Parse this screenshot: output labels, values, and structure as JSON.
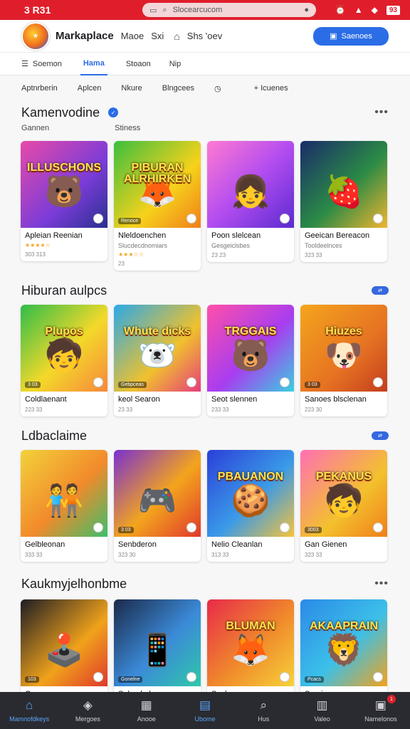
{
  "status": {
    "time": "3 R31",
    "url": "Slocearcucom",
    "battery": "93"
  },
  "appbar": {
    "brand": "Markaplace",
    "nav1": "Maoe",
    "nav2": "Sxi",
    "nav3": "Shs 'oev",
    "cta_label": "Saenoes"
  },
  "tabs": [
    {
      "label": "Soemon",
      "active": false
    },
    {
      "label": "Hama",
      "active": true
    },
    {
      "label": "Stoaon",
      "active": false
    },
    {
      "label": "Nip",
      "active": false
    }
  ],
  "filters": [
    "Aptnrberin",
    "Aplcen",
    "Nkure",
    "Blngcees",
    "+ Icuenes"
  ],
  "sections": [
    {
      "title": "Kamenvodine",
      "verified": true,
      "trailing": "dots",
      "sublabels": [
        "Gannen",
        "Stiness"
      ],
      "cards": [
        {
          "art_title": "ILLUSCHONS",
          "glyph": "🐻",
          "bg": "linear-gradient(135deg,#e84aa8,#7a3cd8 60%,#2b2f8f)",
          "name": "Apleian Reenian",
          "desc": "",
          "stars": "★★★★☆",
          "price": "303 313",
          "badge": ""
        },
        {
          "art_title": "PIBURAN ALRHIRKEN",
          "glyph": "🦊",
          "bg": "linear-gradient(135deg,#3bbf3f,#f6d21b 60%,#f07e1a)",
          "name": "Nleldoenchen",
          "desc": "Slucdecdnomiars",
          "stars": "★★★☆☆",
          "price": "23",
          "badge": "Renoce"
        },
        {
          "art_title": "",
          "glyph": "👧",
          "bg": "linear-gradient(135deg,#ff7ad1,#b34df0 50%,#5a2bd0)",
          "name": "Poon slelcean",
          "desc": "Gesgeiclsbes",
          "stars": "",
          "price": "23 23",
          "badge": ""
        },
        {
          "art_title": "",
          "glyph": "🍓",
          "bg": "linear-gradient(135deg,#1a2b6a,#2a8a46 55%,#f1b52e)",
          "name": "Geeican Bereacon",
          "desc": "Tooldeelnces",
          "stars": "",
          "price": "323 33",
          "badge": ""
        }
      ]
    },
    {
      "title": "Hiburan aulpcs",
      "verified": false,
      "trailing": "pill",
      "sublabels": [],
      "cards": [
        {
          "art_title": "Plupos",
          "glyph": "🧒",
          "bg": "linear-gradient(135deg,#2ebd4a,#f3d92a 55%,#f7873a)",
          "name": "Coldlaenant",
          "desc": "",
          "stars": "",
          "price": "223 33",
          "badge": "3 03"
        },
        {
          "art_title": "Whute dicks",
          "glyph": "🐻‍❄️",
          "bg": "linear-gradient(135deg,#2aa9e8,#f0c12d 60%,#e63d7d)",
          "name": "keol Searon",
          "desc": "",
          "stars": "",
          "price": "23 33",
          "badge": "Gebpceas"
        },
        {
          "art_title": "TRGGAIS",
          "glyph": "🐻",
          "bg": "linear-gradient(135deg,#ff4fa8,#a83df0 55%,#3ad0e0)",
          "name": "Seot slennen",
          "desc": "",
          "stars": "",
          "price": "233 33",
          "badge": ""
        },
        {
          "art_title": "Hiuzes",
          "glyph": "🐶",
          "bg": "linear-gradient(135deg,#f4a51d,#e67322 60%,#c43d1d)",
          "name": "Sanoes blsclenan",
          "desc": "",
          "stars": "",
          "price": "223 30",
          "badge": "3 03"
        }
      ]
    },
    {
      "title": "Ldbaclaime",
      "verified": false,
      "trailing": "pill",
      "sublabels": [],
      "cards": [
        {
          "art_title": "",
          "glyph": "🧑‍🤝‍🧑",
          "bg": "linear-gradient(135deg,#f2d23a,#f28a2b 55%,#3cbf6b)",
          "name": "Gelbleonan",
          "desc": "",
          "stars": "",
          "price": "333 33",
          "badge": ""
        },
        {
          "art_title": "",
          "glyph": "🎮",
          "bg": "linear-gradient(135deg,#7a2fd0,#f3a51d 55%,#e0382b)",
          "name": "Senbderon",
          "desc": "",
          "stars": "",
          "price": "323 30",
          "badge": "3 03"
        },
        {
          "art_title": "PBAUANON",
          "glyph": "🍪",
          "bg": "linear-gradient(135deg,#2b3fd8,#3a9ae8 55%,#f6c33a)",
          "name": "Nelio Cleanlan",
          "desc": "",
          "stars": "",
          "price": "313 33",
          "badge": ""
        },
        {
          "art_title": "PEKANUS",
          "glyph": "🧒",
          "bg": "linear-gradient(135deg,#ff6fb5,#f3c12d 60%,#f07e1a)",
          "name": "Gan Gienen",
          "desc": "",
          "stars": "",
          "price": "323 33",
          "badge": "3003"
        }
      ]
    },
    {
      "title": "Kaukmyjelhonbme",
      "verified": false,
      "trailing": "dots",
      "sublabels": [],
      "cards": [
        {
          "art_title": "",
          "glyph": "🕹️",
          "bg": "linear-gradient(135deg,#1d1d25,#f0a21b 60%,#e0382b)",
          "name": "Gas",
          "desc": "",
          "stars": "",
          "price": "",
          "badge": "103"
        },
        {
          "art_title": "",
          "glyph": "📱",
          "bg": "linear-gradient(135deg,#1b2a4a,#3b8ad8 55%,#2fc8a8)",
          "name": "Salue bol",
          "desc": "",
          "stars": "",
          "price": "",
          "badge": "Gonelne"
        },
        {
          "art_title": "BLUMAN",
          "glyph": "🦊",
          "bg": "linear-gradient(135deg,#e82a4a,#f08a2b 55%,#f6d23a)",
          "name": "Seclon",
          "desc": "",
          "stars": "",
          "price": "",
          "badge": ""
        },
        {
          "art_title": "AKAAPRAIN",
          "glyph": "🦁",
          "bg": "linear-gradient(135deg,#2b8ae8,#3cc0e8 55%,#f3a21b)",
          "name": "Sereion",
          "desc": "",
          "stars": "",
          "price": "",
          "badge": "Pcacs"
        }
      ]
    }
  ],
  "bottomnav": [
    {
      "label": "Mamnofdkeys",
      "icon": "home-icon",
      "glyph": "⌂",
      "active": true
    },
    {
      "label": "Mergoes",
      "icon": "compass-icon",
      "glyph": "◈",
      "active": false
    },
    {
      "label": "Anooe",
      "icon": "grid-icon",
      "glyph": "▦",
      "active": false
    },
    {
      "label": "Ubome",
      "icon": "store-icon",
      "glyph": "▤",
      "active": true
    },
    {
      "label": "Hus",
      "icon": "search-icon",
      "glyph": "⌕",
      "active": false
    },
    {
      "label": "Valeo",
      "icon": "library-icon",
      "glyph": "▥",
      "active": false
    },
    {
      "label": "Namelonos",
      "icon": "inbox-icon",
      "glyph": "▣",
      "active": false,
      "notif": "1"
    }
  ]
}
